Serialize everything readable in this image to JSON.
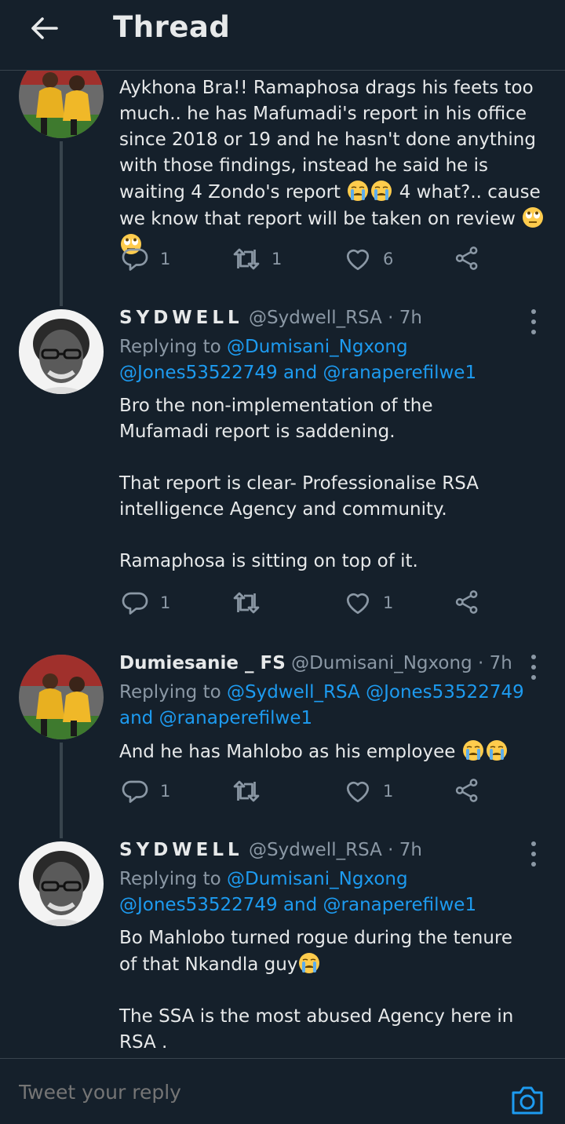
{
  "header": {
    "title": "Thread"
  },
  "tweets": [
    {
      "text_lines": [
        "Aykhona Bra!! Ramaphosa drags his feets too much.. he has Mafumadi's report in his office since 2018 or 19 and he hasn't done anything with those findings, instead he said he is waiting 4 Zondo's report",
        " 4 what?.. cause we know that report will be taken on review"
      ],
      "replies": "1",
      "retweets": "1",
      "likes": "6"
    },
    {
      "name": "SYDWELL",
      "handle": "@Sydwell_RSA",
      "time": "· 7h",
      "replying_prefix": "Replying to",
      "mentions": [
        "@Dumisani_Ngxong",
        "@Jones53522749",
        "@ranaperefilwe1"
      ],
      "and": "and",
      "paragraphs": [
        "Bro the non-implementation of the Mufamadi report is saddening.",
        "That report is clear- Professionalise RSA intelligence Agency and community.",
        "Ramaphosa is sitting on top of it."
      ],
      "replies": "1",
      "retweets": "",
      "likes": "1"
    },
    {
      "name": "Dumiesanie _ FS",
      "handle": "@Dumisani_Ngxong",
      "time": "· 7h",
      "replying_prefix": "Replying to",
      "mentions": [
        "@Sydwell_RSA",
        "@Jones53522749",
        "@ranaperefilwe1"
      ],
      "and": "and",
      "text": "And he has Mahlobo as his employee",
      "replies": "1",
      "retweets": "",
      "likes": "1"
    },
    {
      "name": "SYDWELL",
      "handle": "@Sydwell_RSA",
      "time": "· 7h",
      "replying_prefix": "Replying to",
      "mentions": [
        "@Dumisani_Ngxong",
        "@Jones53522749",
        "@ranaperefilwe1"
      ],
      "and": "and",
      "paragraphs": [
        "Bo Mahlobo turned rogue during the tenure of that Nkandla guy",
        "The SSA is the most abused Agency here in RSA ."
      ]
    }
  ],
  "composer": {
    "placeholder": "Tweet your reply"
  },
  "icons": {
    "back": "arrow-left-icon",
    "more": "more-vertical-icon",
    "reply": "reply-icon",
    "retweet": "retweet-icon",
    "like": "heart-icon",
    "share": "share-icon",
    "camera": "camera-icon"
  },
  "colors": {
    "background": "#15202b",
    "accent": "#1d9bf0",
    "text": "#e7e9ea",
    "muted": "#8b98a5",
    "divider": "#38444d"
  }
}
